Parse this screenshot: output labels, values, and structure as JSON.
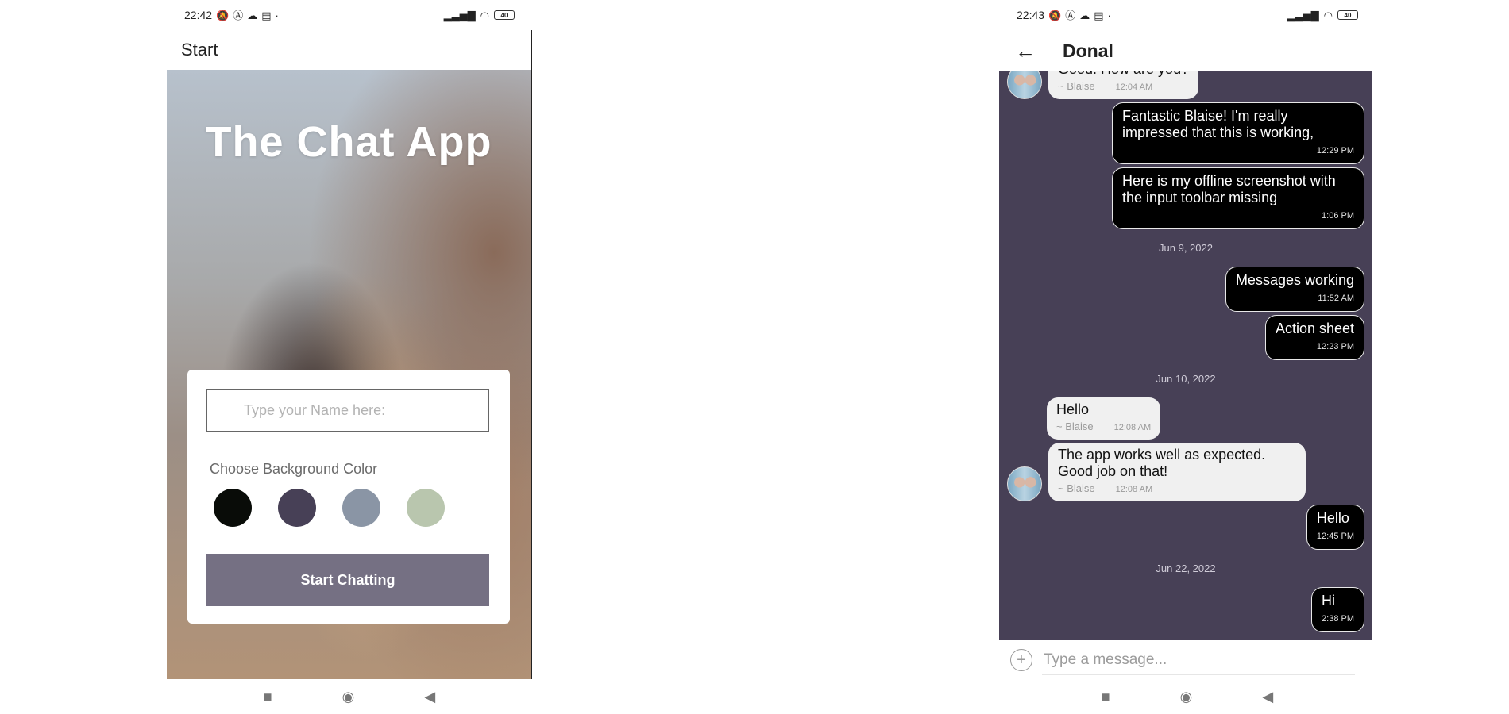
{
  "start_screen": {
    "status": {
      "time": "22:42",
      "battery": "40"
    },
    "appbar_title": "Start",
    "hero_title": "The Chat App",
    "name_input": {
      "placeholder": "Type your Name here:",
      "value": ""
    },
    "choose_label": "Choose Background Color",
    "colors": [
      "#090C08",
      "#474056",
      "#8A95A5",
      "#B9C6AE"
    ],
    "start_button": "Start Chatting"
  },
  "chat_screen": {
    "status": {
      "time": "22:43",
      "battery": "40"
    },
    "title": "Donal",
    "messages": [
      {
        "type": "left",
        "avatar": true,
        "text": "Good. How are you?",
        "author": "~ Blaise",
        "time": "12:04 AM"
      },
      {
        "type": "right",
        "text": "Fantastic Blaise! I'm really impressed that this is working,",
        "time": "12:29 PM"
      },
      {
        "type": "right",
        "text": "Here is my offline screenshot with the input toolbar missing",
        "time": "1:06 PM"
      },
      {
        "type": "date",
        "text": "Jun 9, 2022"
      },
      {
        "type": "right",
        "text": "Messages working",
        "time": "11:52 AM"
      },
      {
        "type": "right",
        "text": "Action sheet",
        "time": "12:23 PM"
      },
      {
        "type": "date",
        "text": "Jun 10, 2022"
      },
      {
        "type": "left",
        "avatar": false,
        "text": "Hello",
        "author": "~ Blaise",
        "time": "12:08 AM"
      },
      {
        "type": "left",
        "avatar": true,
        "text": "The app works well as expected. Good job on that!",
        "author": "~ Blaise",
        "time": "12:08 AM"
      },
      {
        "type": "right",
        "text": "Hello",
        "time": "12:45 PM"
      },
      {
        "type": "date",
        "text": "Jun 22, 2022"
      },
      {
        "type": "right",
        "text": "Hi",
        "time": "2:38 PM"
      }
    ],
    "composer": {
      "placeholder": "Type a message...",
      "plus_icon": "+"
    }
  },
  "navbar": {
    "recents": "■",
    "home": "◉",
    "back": "◀"
  }
}
